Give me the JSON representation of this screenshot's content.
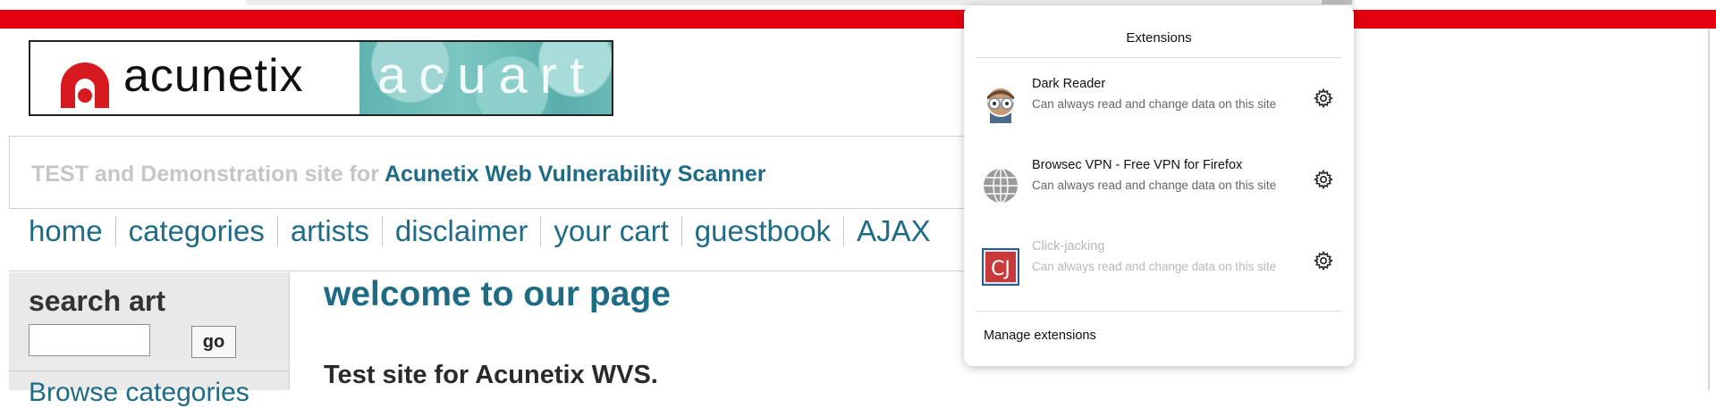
{
  "site": {
    "logo_brand": "acunetix",
    "logo_art": "acuart",
    "tagline_prefix": "TEST and Demonstration site for ",
    "tagline_highlight": "Acunetix Web Vulnerability Scanner",
    "nav": [
      "home",
      "categories",
      "artists",
      "disclaimer",
      "your cart",
      "guestbook",
      "AJAX"
    ],
    "search": {
      "title": "search art",
      "input_value": "",
      "button_label": "go"
    },
    "browse_label": "Browse categories",
    "welcome": "welcome to our page",
    "intro": "Test site for Acunetix WVS."
  },
  "extensions_panel": {
    "title": "Extensions",
    "items": [
      {
        "name": "Dark Reader",
        "desc": "Can always read and change data on this site",
        "icon": "dark-reader-icon",
        "enabled": true
      },
      {
        "name": "Browsec VPN - Free VPN for Firefox",
        "desc": "Can always read and change data on this site",
        "icon": "globe-icon",
        "enabled": true
      },
      {
        "name": "Click-jacking",
        "desc": "Can always read and change data on this site",
        "icon": "cj-icon",
        "icon_text": "CJ",
        "enabled": false
      }
    ],
    "manage_label": "Manage extensions"
  },
  "colors": {
    "accent_red": "#e3000f",
    "link_blue": "#1e6b86"
  }
}
